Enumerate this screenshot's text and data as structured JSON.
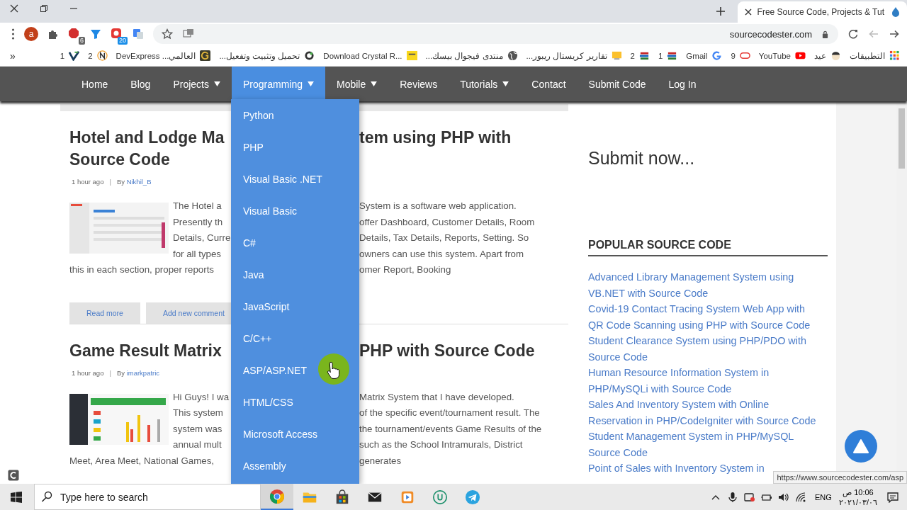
{
  "browser": {
    "tab_title": "Free Source Code, Projects & Tut",
    "address": "sourcecodester.com",
    "avatar": "a",
    "extension_badges": [
      "6",
      "20"
    ],
    "more": "»",
    "bookmarks": [
      {
        "label": "1",
        "kind": "v"
      },
      {
        "label": "2",
        "kind": "n"
      },
      {
        "label": "العالمي... DevExpress",
        "kind": "g"
      },
      {
        "label": "تحميل وتثبيت وتفعيل...",
        "kind": "ring"
      },
      {
        "label": "Download Crystal R...",
        "kind": "tek"
      },
      {
        "label": "منتدى فيجوال بيسك...",
        "kind": "globe"
      },
      {
        "label": "تقارير كريستال ريبور...",
        "kind": "note"
      },
      {
        "label": "2",
        "kind": "books"
      },
      {
        "label": "1",
        "kind": "books"
      },
      {
        "label": "Gmail",
        "kind": "google"
      },
      {
        "label": "9",
        "kind": "oval"
      },
      {
        "label": "YouTube",
        "kind": "youtube"
      },
      {
        "label": "عيد",
        "kind": "face"
      },
      {
        "label": "التطبيقات",
        "kind": "apps"
      }
    ]
  },
  "nav": [
    {
      "label": "Home",
      "has_dropdown": false,
      "selected": false
    },
    {
      "label": "Blog",
      "has_dropdown": false,
      "selected": false
    },
    {
      "label": "Projects",
      "has_dropdown": true,
      "selected": false
    },
    {
      "label": "Programming",
      "has_dropdown": true,
      "selected": true
    },
    {
      "label": "Mobile",
      "has_dropdown": true,
      "selected": false
    },
    {
      "label": "Reviews",
      "has_dropdown": false,
      "selected": false
    },
    {
      "label": "Tutorials",
      "has_dropdown": true,
      "selected": false
    },
    {
      "label": "Contact",
      "has_dropdown": false,
      "selected": false
    },
    {
      "label": "Submit Code",
      "has_dropdown": false,
      "selected": false
    },
    {
      "label": "Log In",
      "has_dropdown": false,
      "selected": false
    }
  ],
  "dropdown": [
    "Python",
    "PHP",
    "Visual Basic .NET",
    "Visual Basic",
    "C#",
    "Java",
    "JavaScript",
    "C/C++",
    "ASP/ASP.NET",
    "HTML/CSS",
    "Microsoft Access",
    "Assembly"
  ],
  "articles": [
    {
      "title_lines": [
        {
          "left": "Hotel and Lodge Ma",
          "right": "tem using PHP with"
        },
        {
          "left": "Source Code"
        }
      ],
      "time": "1 hour ago",
      "separator": "|",
      "by": "By",
      "author": "Nikhil_B",
      "thumbnail": {
        "kind": "picture"
      },
      "excerpt_lines": [
        {
          "left": "The Hotel a",
          "right": "System is a software web application."
        },
        {
          "left": "Presently th",
          "right": "offer Dashboard, Customer Details, Room"
        },
        {
          "left": "Details, Curre",
          "right": "Details, Tax Details, Reports, Setting. So"
        },
        {
          "left": "for all types",
          "right": "owners can use this system. Apart from"
        },
        {
          "left": "this in each section, proper reports",
          "right": "omer Report, Booking"
        }
      ],
      "buttons": [
        "Read more",
        "Add new comment"
      ]
    },
    {
      "title_lines": [
        {
          "left": "Game Result Matrix",
          "right": "PHP with Source Code"
        }
      ],
      "time": "1 hour ago",
      "separator": "|",
      "by": "By",
      "author": "imarkpatric",
      "thumbnail": {
        "kind": "picture"
      },
      "excerpt_lines": [
        {
          "left": "Hi Guys! I wa",
          "right": "Matrix System that I have developed."
        },
        {
          "left": "This system",
          "right": "of the specific event/tournament result. The"
        },
        {
          "left": "system was",
          "right": "the tournament/events Game Results of the"
        },
        {
          "left": "annual mult",
          "right": "such as the School Intramurals, District"
        },
        {
          "left": "Meet, Area Meet, National Games,",
          "right": "generates"
        }
      ]
    }
  ],
  "sidebar": {
    "submit": "Submit now...",
    "popular_title": "POPULAR SOURCE CODE",
    "popular_links": [
      "Advanced Library Management System using VB.NET with Source Code",
      "Covid-19 Contact Tracing System Web App with QR Code Scanning using PHP with Source Code",
      "Student Clearance System using PHP/PDO with Source Code",
      "Human Resource Information System in PHP/MySQLi with Source Code",
      "Sales And Inventory System with Online Reservation in PHP/CodeIgniter with Source Code",
      "Student Management System in PHP/MySQL Source Code",
      "Point of Sales with Inventory System in"
    ]
  },
  "status_url": "https://www.sourcecodester.com/asp",
  "taskbar": {
    "search_placeholder": "Type here to search",
    "apps": [
      {
        "kind": "chrome",
        "active": true
      },
      {
        "kind": "folder",
        "active": false
      },
      {
        "kind": "store",
        "active": false
      },
      {
        "kind": "mail",
        "active": false
      },
      {
        "kind": "media",
        "active": false
      },
      {
        "kind": "u",
        "active": false
      },
      {
        "kind": "telegram",
        "active": false
      }
    ],
    "language": "ENG",
    "time": "10:06 ص",
    "date": "٢٠٢١/٠٣/٠٦"
  }
}
